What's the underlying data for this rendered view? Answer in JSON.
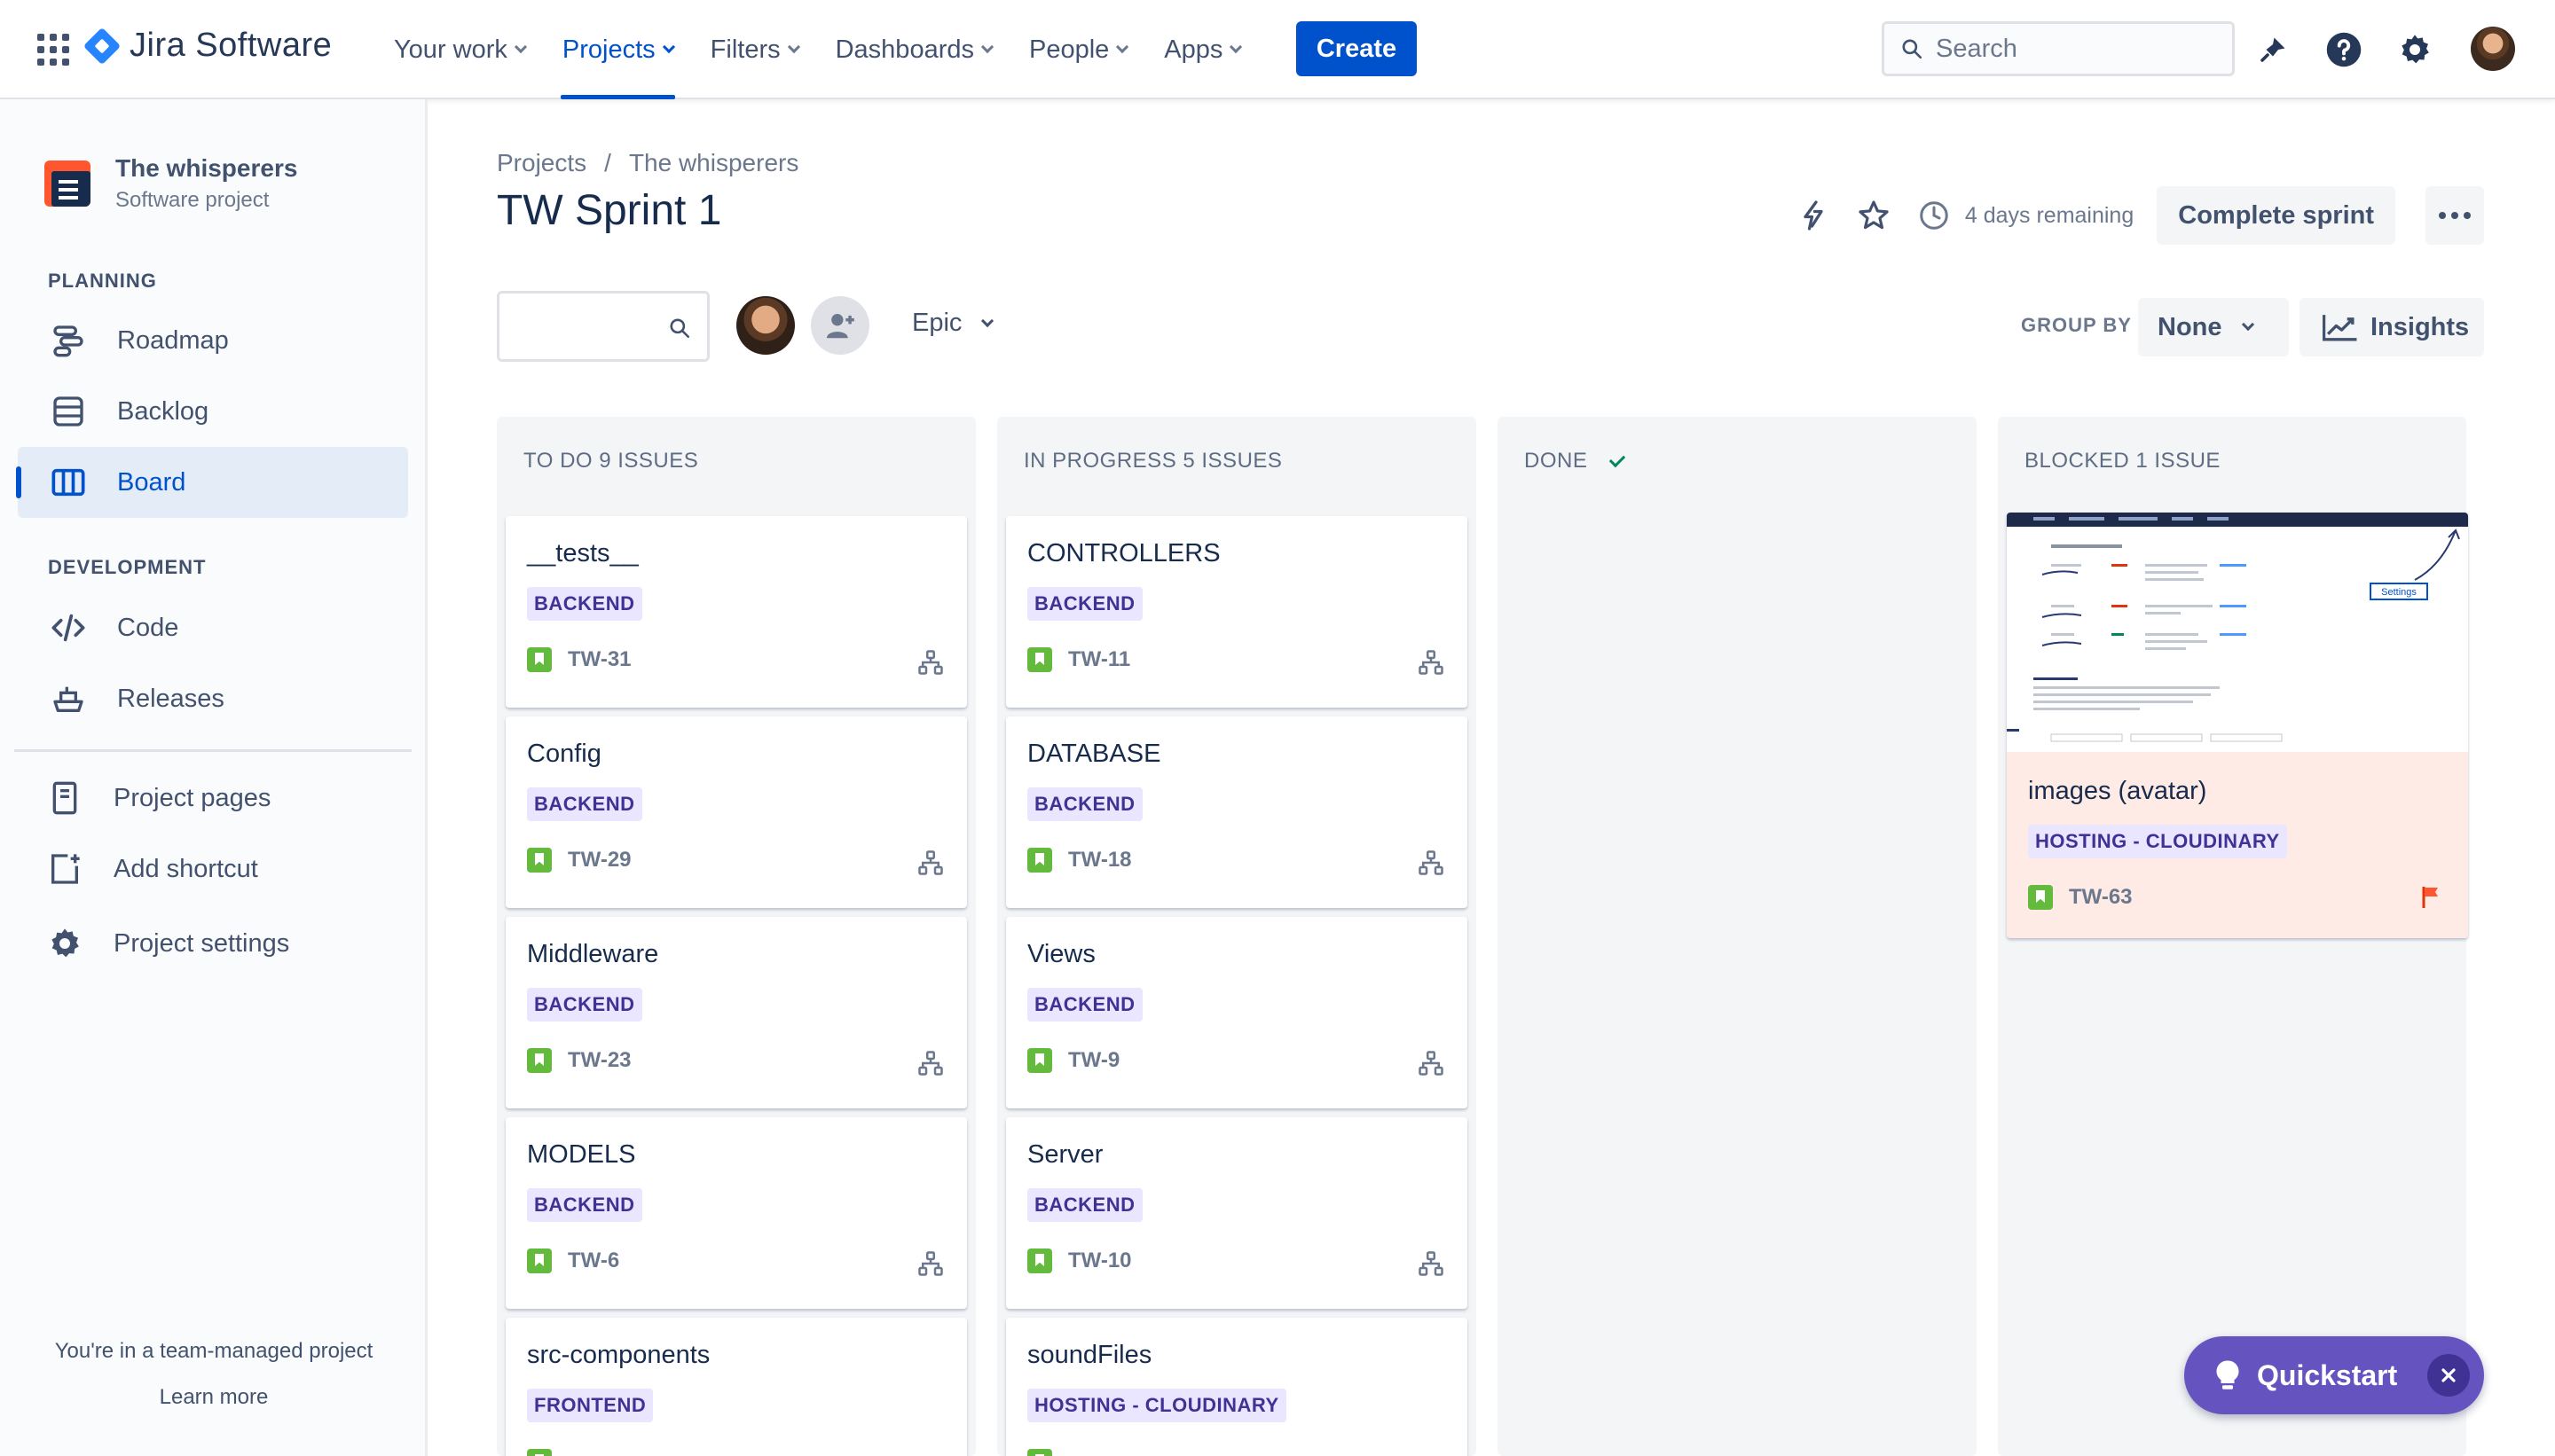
{
  "app": {
    "name": "Jira Software"
  },
  "nav": {
    "items": [
      {
        "label": "Your work"
      },
      {
        "label": "Projects"
      },
      {
        "label": "Filters"
      },
      {
        "label": "Dashboards"
      },
      {
        "label": "People"
      },
      {
        "label": "Apps"
      }
    ],
    "create_label": "Create",
    "search_placeholder": "Search"
  },
  "sidebar": {
    "project_name": "The whisperers",
    "project_type": "Software project",
    "planning_label": "PLANNING",
    "planning_items": [
      {
        "label": "Roadmap",
        "icon": "roadmap-icon"
      },
      {
        "label": "Backlog",
        "icon": "backlog-icon"
      },
      {
        "label": "Board",
        "icon": "board-icon"
      }
    ],
    "development_label": "DEVELOPMENT",
    "development_items": [
      {
        "label": "Code",
        "icon": "code-icon"
      },
      {
        "label": "Releases",
        "icon": "releases-icon"
      }
    ],
    "extra_items": [
      {
        "label": "Project pages",
        "icon": "project-pages-icon"
      },
      {
        "label": "Add shortcut",
        "icon": "add-shortcut-icon"
      },
      {
        "label": "Project settings",
        "icon": "gear-icon"
      }
    ],
    "footer_text": "You're in a team-managed project",
    "footer_link": "Learn more"
  },
  "header": {
    "breadcrumbs": [
      "Projects",
      "The whisperers"
    ],
    "title": "TW Sprint 1",
    "days_remaining": "4 days remaining",
    "complete_sprint_label": "Complete sprint"
  },
  "filters": {
    "epic_label": "Epic",
    "group_by_label": "GROUP BY",
    "group_by_value": "None",
    "insights_label": "Insights"
  },
  "columns": [
    {
      "title": "TO DO 9 ISSUES",
      "cards": [
        {
          "title": "__tests__",
          "epic": "BACKEND",
          "key": "TW-31"
        },
        {
          "title": "Config",
          "epic": "BACKEND",
          "key": "TW-29"
        },
        {
          "title": "Middleware",
          "epic": "BACKEND",
          "key": "TW-23"
        },
        {
          "title": "MODELS",
          "epic": "BACKEND",
          "key": "TW-6"
        },
        {
          "title": "src-components",
          "epic": "FRONTEND",
          "key": ""
        }
      ]
    },
    {
      "title": "IN PROGRESS 5 ISSUES",
      "cards": [
        {
          "title": "CONTROLLERS",
          "epic": "BACKEND",
          "key": "TW-11"
        },
        {
          "title": "DATABASE",
          "epic": "BACKEND",
          "key": "TW-18"
        },
        {
          "title": "Views",
          "epic": "BACKEND",
          "key": "TW-9"
        },
        {
          "title": "Server",
          "epic": "BACKEND",
          "key": "TW-10"
        },
        {
          "title": "soundFiles",
          "epic": "HOSTING - CLOUDINARY",
          "key": ""
        }
      ]
    },
    {
      "title": "DONE",
      "cards": []
    },
    {
      "title": "BLOCKED 1 ISSUE",
      "cards": [
        {
          "title": "images (avatar)",
          "epic": "HOSTING - CLOUDINARY",
          "key": "TW-63",
          "flagged": true,
          "thumbnail_label": "Settings"
        }
      ]
    }
  ],
  "quickstart": {
    "label": "Quickstart"
  },
  "colors": {
    "brand_blue": "#0052cc",
    "epic_bg": "#eae6ff",
    "epic_text": "#403294",
    "story_green": "#63ba3c",
    "flagged_bg": "#ffebe6",
    "quickstart_purple": "#6554c0"
  }
}
